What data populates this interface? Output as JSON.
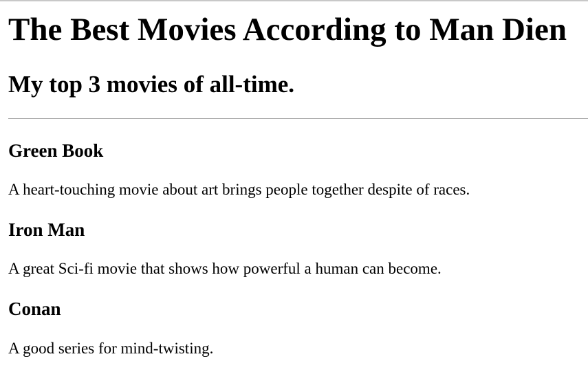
{
  "header": {
    "title": "The Best Movies According to Man Dien",
    "subtitle": "My top 3 movies of all-time."
  },
  "movies": [
    {
      "title": "Green Book",
      "description": "A heart-touching movie about art brings people together despite of races."
    },
    {
      "title": "Iron Man",
      "description": "A great Sci-fi movie that shows how powerful a human can become."
    },
    {
      "title": "Conan",
      "description": "A good series for mind-twisting."
    }
  ]
}
